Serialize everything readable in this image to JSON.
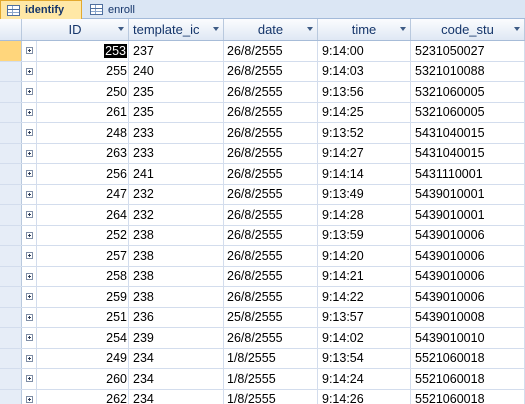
{
  "tabs": [
    {
      "label": "identify",
      "active": true
    },
    {
      "label": "enroll",
      "active": false
    }
  ],
  "columns": [
    {
      "label": "ID",
      "sort": true
    },
    {
      "label": "template_ic",
      "sort": true
    },
    {
      "label": "date",
      "sort": true
    },
    {
      "label": "time",
      "sort": true,
      "filtered": true
    },
    {
      "label": "code_stu",
      "sort": true
    }
  ],
  "rows": [
    {
      "id": "253",
      "template": "237",
      "date": "26/8/2555",
      "time": "9:14:00",
      "code": "5231050027",
      "current": true
    },
    {
      "id": "255",
      "template": "240",
      "date": "26/8/2555",
      "time": "9:14:03",
      "code": "5321010088"
    },
    {
      "id": "250",
      "template": "235",
      "date": "26/8/2555",
      "time": "9:13:56",
      "code": "5321060005"
    },
    {
      "id": "261",
      "template": "235",
      "date": "26/8/2555",
      "time": "9:14:25",
      "code": "5321060005"
    },
    {
      "id": "248",
      "template": "233",
      "date": "26/8/2555",
      "time": "9:13:52",
      "code": "5431040015"
    },
    {
      "id": "263",
      "template": "233",
      "date": "26/8/2555",
      "time": "9:14:27",
      "code": "5431040015"
    },
    {
      "id": "256",
      "template": "241",
      "date": "26/8/2555",
      "time": "9:14:14",
      "code": "5431110001"
    },
    {
      "id": "247",
      "template": "232",
      "date": "26/8/2555",
      "time": "9:13:49",
      "code": "5439010001"
    },
    {
      "id": "264",
      "template": "232",
      "date": "26/8/2555",
      "time": "9:14:28",
      "code": "5439010001"
    },
    {
      "id": "252",
      "template": "238",
      "date": "26/8/2555",
      "time": "9:13:59",
      "code": "5439010006"
    },
    {
      "id": "257",
      "template": "238",
      "date": "26/8/2555",
      "time": "9:14:20",
      "code": "5439010006"
    },
    {
      "id": "258",
      "template": "238",
      "date": "26/8/2555",
      "time": "9:14:21",
      "code": "5439010006"
    },
    {
      "id": "259",
      "template": "238",
      "date": "26/8/2555",
      "time": "9:14:22",
      "code": "5439010006"
    },
    {
      "id": "251",
      "template": "236",
      "date": "25/8/2555",
      "time": "9:13:57",
      "code": "5439010008"
    },
    {
      "id": "254",
      "template": "239",
      "date": "26/8/2555",
      "time": "9:14:02",
      "code": "5439010010"
    },
    {
      "id": "249",
      "template": "234",
      "date": "1/8/2555",
      "time": "9:13:54",
      "code": "5521060018"
    },
    {
      "id": "260",
      "template": "234",
      "date": "1/8/2555",
      "time": "9:14:24",
      "code": "5521060018"
    },
    {
      "id": "262",
      "template": "234",
      "date": "1/8/2555",
      "time": "9:14:26",
      "code": "5521060018"
    }
  ]
}
